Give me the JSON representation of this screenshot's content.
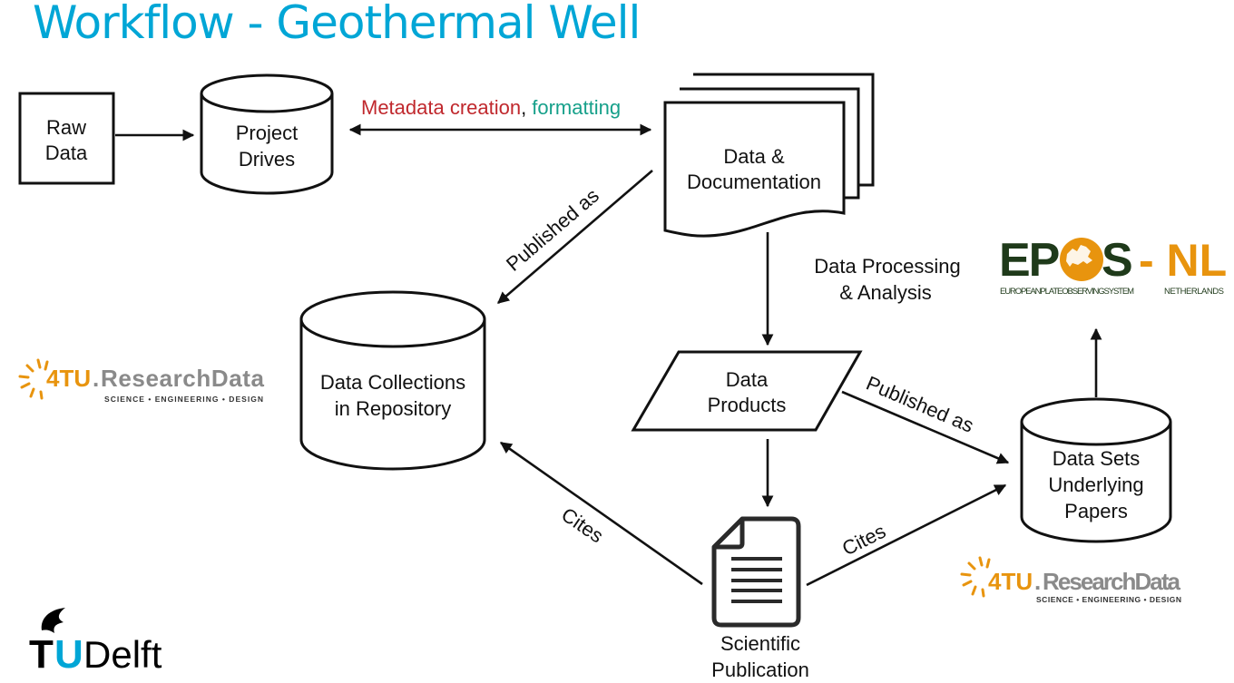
{
  "title": "Workflow - Geothermal Well",
  "nodes": {
    "raw_data": [
      "Raw",
      "Data"
    ],
    "project_drives": [
      "Project",
      "Drives"
    ],
    "data_documentation": [
      "Data &",
      "Documentation"
    ],
    "data_collections": [
      "Data Collections",
      "in Repository"
    ],
    "data_products": [
      "Data",
      "Products"
    ],
    "data_sets": [
      "Data Sets",
      "Underlying",
      "Papers"
    ],
    "scientific_publication": [
      "Scientific",
      "Publication"
    ]
  },
  "edges": {
    "metadata_part1": "Metadata creation",
    "metadata_sep": ",",
    "metadata_part2": "formatting",
    "published_as_left": "Published as",
    "processing": [
      "Data Processing",
      "& Analysis"
    ],
    "published_as_right": "Published as",
    "cites_left": "Cites",
    "cites_right": "Cites"
  },
  "colors": {
    "title": "#00A6D6",
    "metadata_creation": "#C0282D",
    "formatting": "#16A08A",
    "orange": "#E8940E",
    "epos_green": "#1F3A1A",
    "grey": "#8A8A8A"
  },
  "logos": {
    "fourtu_left": {
      "brand": "4TU",
      "dot": ".",
      "name": "ResearchData",
      "tagline": "SCIENCE • ENGINEERING • DESIGN"
    },
    "fourtu_right": {
      "brand": "4TU",
      "dot": ".",
      "name": "ResearchData",
      "tagline": "SCIENCE • ENGINEERING • DESIGN"
    },
    "epos": {
      "ep": "EP",
      "s": "S",
      "dash_nl": "- NL",
      "tagline": "EUROPEANPLATEOBSERVINGSYSTEM",
      "country": "NETHERLANDS"
    },
    "tudelft": {
      "t": "T",
      "u": "U",
      "rest": "Delft"
    }
  }
}
